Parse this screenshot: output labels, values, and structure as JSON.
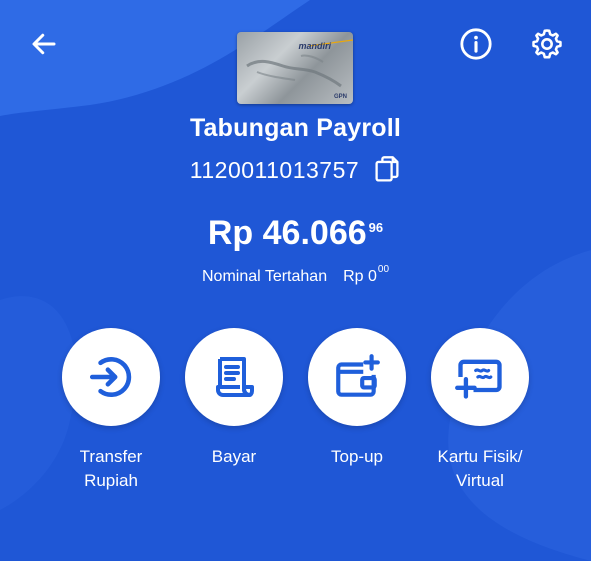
{
  "header": {
    "back_icon": "arrow-left-icon",
    "info_icon": "info-icon",
    "settings_icon": "gear-icon"
  },
  "card": {
    "brand": "mandiri",
    "network": "GPN"
  },
  "account": {
    "name": "Tabungan Payroll",
    "number": "1120011013757",
    "copy_icon": "copy-icon"
  },
  "balance": {
    "main": "Rp 46.066",
    "decimals": "96"
  },
  "hold": {
    "label": "Nominal Tertahan",
    "amount": "Rp 0",
    "decimals": "00"
  },
  "actions": [
    {
      "label_1": "Transfer",
      "label_2": "Rupiah",
      "icon": "transfer-icon"
    },
    {
      "label_1": "Bayar",
      "label_2": "",
      "icon": "bill-icon"
    },
    {
      "label_1": "Top-up",
      "label_2": "",
      "icon": "wallet-plus-icon"
    },
    {
      "label_1": "Kartu Fisik/",
      "label_2": "Virtual",
      "icon": "card-plus-icon"
    }
  ],
  "colors": {
    "background": "#1f57d6",
    "wave_light": "#2f6be6",
    "icon_blue": "#1f5fdb"
  }
}
